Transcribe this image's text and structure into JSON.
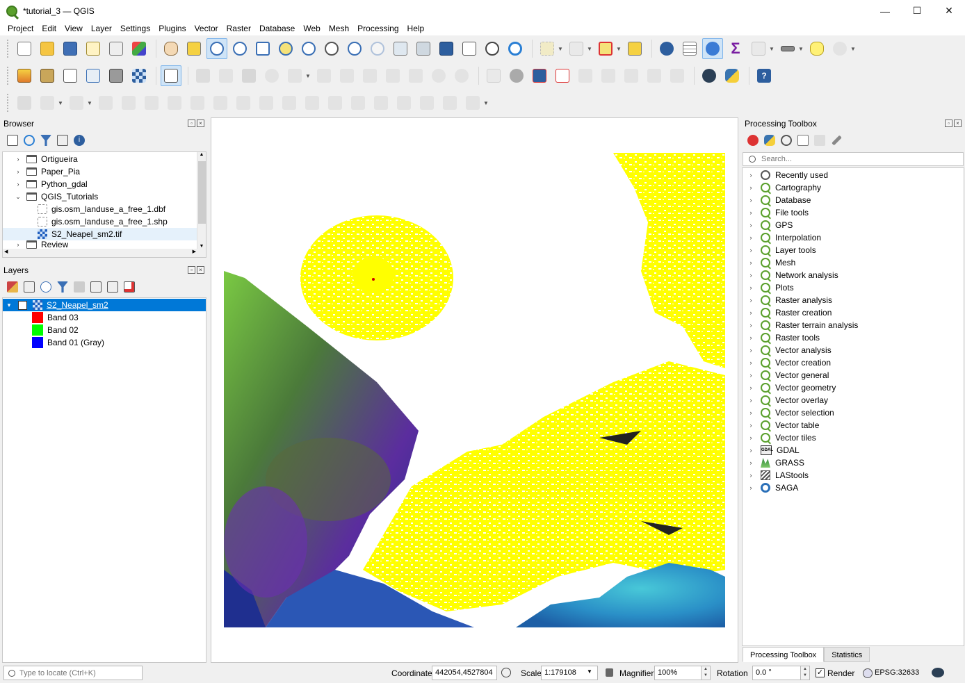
{
  "window": {
    "title": "*tutorial_3 — QGIS",
    "minimize": "—",
    "maximize": "☐",
    "close": "✕"
  },
  "menu": [
    "Project",
    "Edit",
    "View",
    "Layer",
    "Settings",
    "Plugins",
    "Vector",
    "Raster",
    "Database",
    "Web",
    "Mesh",
    "Processing",
    "Help"
  ],
  "browser": {
    "title": "Browser",
    "items": [
      {
        "label": "Ortigueira",
        "type": "folder",
        "expandable": true
      },
      {
        "label": "Paper_Pia",
        "type": "folder",
        "expandable": true
      },
      {
        "label": "Python_gdal",
        "type": "folder",
        "expandable": true
      },
      {
        "label": "QGIS_Tutorials",
        "type": "folder",
        "expanded": true
      },
      {
        "label": "gis.osm_landuse_a_free_1.dbf",
        "type": "file"
      },
      {
        "label": "gis.osm_landuse_a_free_1.shp",
        "type": "file"
      },
      {
        "label": "S2_Neapel_sm2.tif",
        "type": "raster"
      },
      {
        "label": "Review",
        "type": "folder",
        "expandable": true
      }
    ]
  },
  "layers": {
    "title": "Layers",
    "layer_name": "S2_Neapel_sm2",
    "bands": [
      {
        "label": "Band 03",
        "color": "#ff0000"
      },
      {
        "label": "Band 02",
        "color": "#00ff00"
      },
      {
        "label": "Band 01 (Gray)",
        "color": "#0000ff"
      }
    ]
  },
  "toolbox": {
    "title": "Processing Toolbox",
    "search_placeholder": "Search...",
    "items": [
      {
        "label": "Recently used",
        "icon": "clock-icon"
      },
      {
        "label": "Cartography",
        "icon": "qgis-icon"
      },
      {
        "label": "Database",
        "icon": "qgis-icon"
      },
      {
        "label": "File tools",
        "icon": "qgis-icon"
      },
      {
        "label": "GPS",
        "icon": "qgis-icon"
      },
      {
        "label": "Interpolation",
        "icon": "qgis-icon"
      },
      {
        "label": "Layer tools",
        "icon": "qgis-icon"
      },
      {
        "label": "Mesh",
        "icon": "qgis-icon"
      },
      {
        "label": "Network analysis",
        "icon": "qgis-icon"
      },
      {
        "label": "Plots",
        "icon": "qgis-icon"
      },
      {
        "label": "Raster analysis",
        "icon": "qgis-icon"
      },
      {
        "label": "Raster creation",
        "icon": "qgis-icon"
      },
      {
        "label": "Raster terrain analysis",
        "icon": "qgis-icon"
      },
      {
        "label": "Raster tools",
        "icon": "qgis-icon"
      },
      {
        "label": "Vector analysis",
        "icon": "qgis-icon"
      },
      {
        "label": "Vector creation",
        "icon": "qgis-icon"
      },
      {
        "label": "Vector general",
        "icon": "qgis-icon"
      },
      {
        "label": "Vector geometry",
        "icon": "qgis-icon"
      },
      {
        "label": "Vector overlay",
        "icon": "qgis-icon"
      },
      {
        "label": "Vector selection",
        "icon": "qgis-icon"
      },
      {
        "label": "Vector table",
        "icon": "qgis-icon"
      },
      {
        "label": "Vector tiles",
        "icon": "qgis-icon"
      },
      {
        "label": "GDAL",
        "icon": "gdal-icon"
      },
      {
        "label": "GRASS",
        "icon": "grass-icon"
      },
      {
        "label": "LAStools",
        "icon": "lastools-icon"
      },
      {
        "label": "SAGA",
        "icon": "saga-icon"
      }
    ],
    "tabs": [
      "Processing Toolbox",
      "Statistics"
    ]
  },
  "status": {
    "locator_placeholder": "Type to locate (Ctrl+K)",
    "coordinate_label": "Coordinate",
    "coordinate_value": "442054,4527804",
    "scale_label": "Scale",
    "scale_value": "1:179108",
    "magnifier_label": "Magnifier",
    "magnifier_value": "100%",
    "rotation_label": "Rotation",
    "rotation_value": "0.0 °",
    "render_label": "Render",
    "crs_label": "EPSG:32633"
  },
  "colors": {
    "selection": "#0078d7",
    "active_tool": "#cfe4f7",
    "raster_yellow": "#ffff00",
    "raster_sea_blue": "#2a8fc7",
    "raster_violet": "#5b2d9e"
  }
}
